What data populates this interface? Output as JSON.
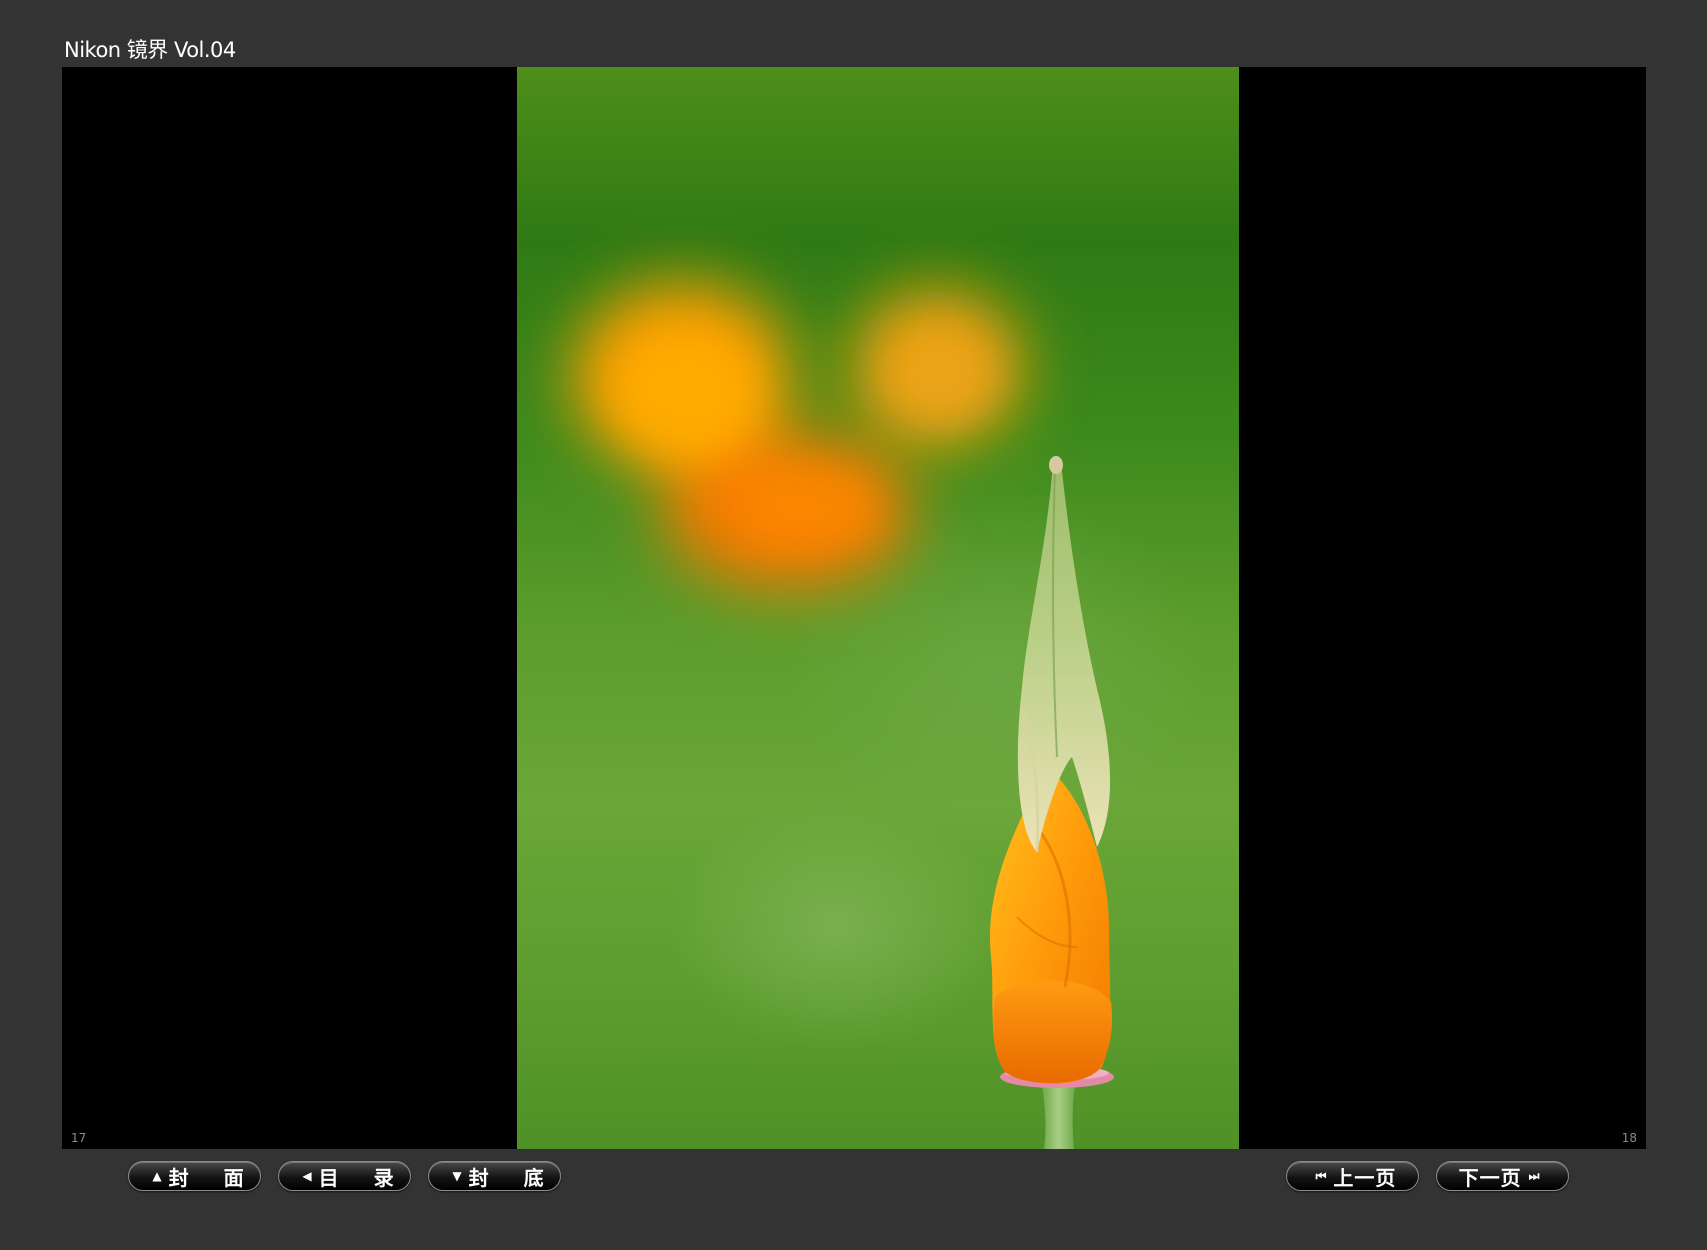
{
  "window": {
    "title": "Nikon 镜界 Vol.04"
  },
  "viewer": {
    "left_page_number": "17",
    "right_page_number": "18"
  },
  "toolbar": {
    "cover_label": "封 面",
    "contents_label": "目 录",
    "back_cover_label": "封 底",
    "prev_page_label": "上一页",
    "next_page_label": "下一页",
    "cover_icon": "triangle-up-icon",
    "contents_icon": "triangle-left-icon",
    "back_cover_icon": "triangle-down-icon",
    "prev_icon": "skip-back-icon",
    "next_icon": "skip-forward-icon"
  },
  "colors": {
    "background": "#333333",
    "viewer_background": "#000000",
    "text": "#ffffff"
  }
}
